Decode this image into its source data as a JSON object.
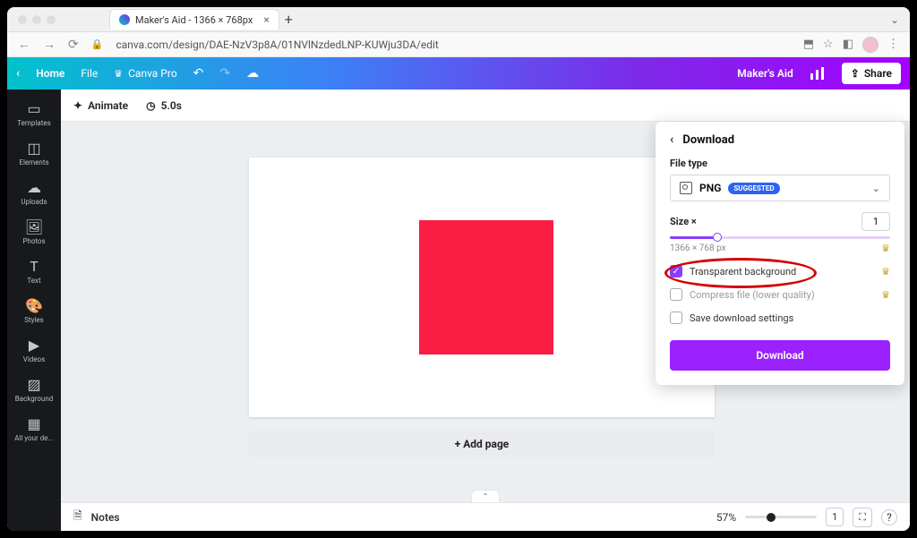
{
  "browser": {
    "tab_title": "Maker's Aid - 1366 × 768px",
    "url": "canva.com/design/DAE-NzV3p8A/01NVlNzdedLNP-KUWju3DA/edit"
  },
  "topbar": {
    "home": "Home",
    "file": "File",
    "canva_pro": "Canva Pro",
    "makers_aid": "Maker's Aid",
    "share": "Share"
  },
  "sidebar": {
    "templates": "Templates",
    "elements": "Elements",
    "uploads": "Uploads",
    "photos": "Photos",
    "text": "Text",
    "styles": "Styles",
    "videos": "Videos",
    "background": "Background",
    "all_your": "All your de..."
  },
  "toolbar": {
    "animate": "Animate",
    "duration": "5.0s"
  },
  "add_page": "+ Add page",
  "bottombar": {
    "notes": "Notes",
    "zoom": "57%",
    "page_count": "1"
  },
  "panel": {
    "title": "Download",
    "file_type_label": "File type",
    "file_type": "PNG",
    "suggested": "SUGGESTED",
    "size_label": "Size ×",
    "size_value": "1",
    "dimensions": "1366 × 768 px",
    "transparent": "Transparent background",
    "compress": "Compress file (lower quality)",
    "save_settings": "Save download settings",
    "download_btn": "Download"
  }
}
